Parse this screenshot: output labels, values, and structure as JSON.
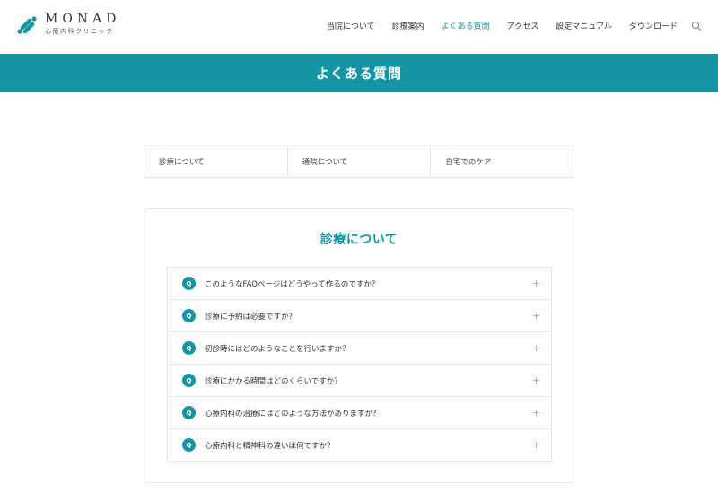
{
  "header": {
    "logo_title": "MONAD",
    "logo_subtitle": "心療内科クリニック",
    "nav": [
      {
        "label": "当院について",
        "active": false
      },
      {
        "label": "診療案内",
        "active": false
      },
      {
        "label": "よくある質問",
        "active": true
      },
      {
        "label": "アクセス",
        "active": false
      },
      {
        "label": "設定マニュアル",
        "active": false
      },
      {
        "label": "ダウンロード",
        "active": false
      }
    ],
    "search_icon": "search-icon"
  },
  "banner": {
    "title": "よくある質問"
  },
  "tabs": [
    {
      "label": "診療について"
    },
    {
      "label": "通院について"
    },
    {
      "label": "自宅でのケア"
    }
  ],
  "faq_section": {
    "title": "診療について",
    "badge": "Q",
    "items": [
      {
        "question": "このようなFAQページはどうやって作るのですか？"
      },
      {
        "question": "診療に予約は必要ですか？"
      },
      {
        "question": "初診時にはどのようなことを行いますか？"
      },
      {
        "question": "診療にかかる時間はどのくらいですか？"
      },
      {
        "question": "心療内科の治療にはどのような方法がありますか？"
      },
      {
        "question": "心療内科と精神科の違いは何ですか？"
      }
    ]
  },
  "colors": {
    "accent": "#1595a3",
    "border": "#e6e6e6",
    "text": "#333333"
  }
}
